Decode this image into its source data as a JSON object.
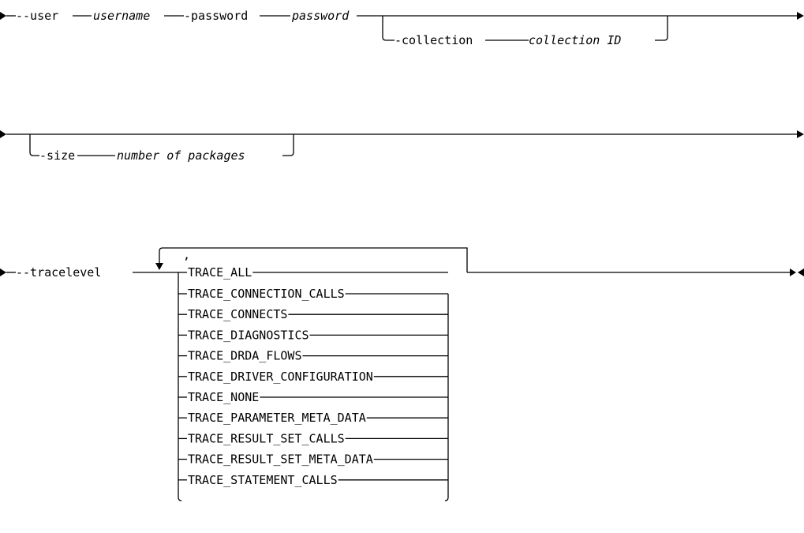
{
  "row1": {
    "user_flag": "--user",
    "username": "username",
    "password_flag": "-password",
    "password": "password",
    "collection_flag": "-collection",
    "collection_id": "collection ID"
  },
  "row2": {
    "size_flag": "-size",
    "packages": "number of packages"
  },
  "row3": {
    "tracelevel_flag": "--tracelevel",
    "separator": ",",
    "options": [
      "TRACE_ALL",
      "TRACE_CONNECTION_CALLS",
      "TRACE_CONNECTS",
      "TRACE_DIAGNOSTICS",
      "TRACE_DRDA_FLOWS",
      "TRACE_DRIVER_CONFIGURATION",
      "TRACE_NONE",
      "TRACE_PARAMETER_META_DATA",
      "TRACE_RESULT_SET_CALLS",
      "TRACE_RESULT_SET_META_DATA",
      "TRACE_STATEMENT_CALLS"
    ]
  }
}
